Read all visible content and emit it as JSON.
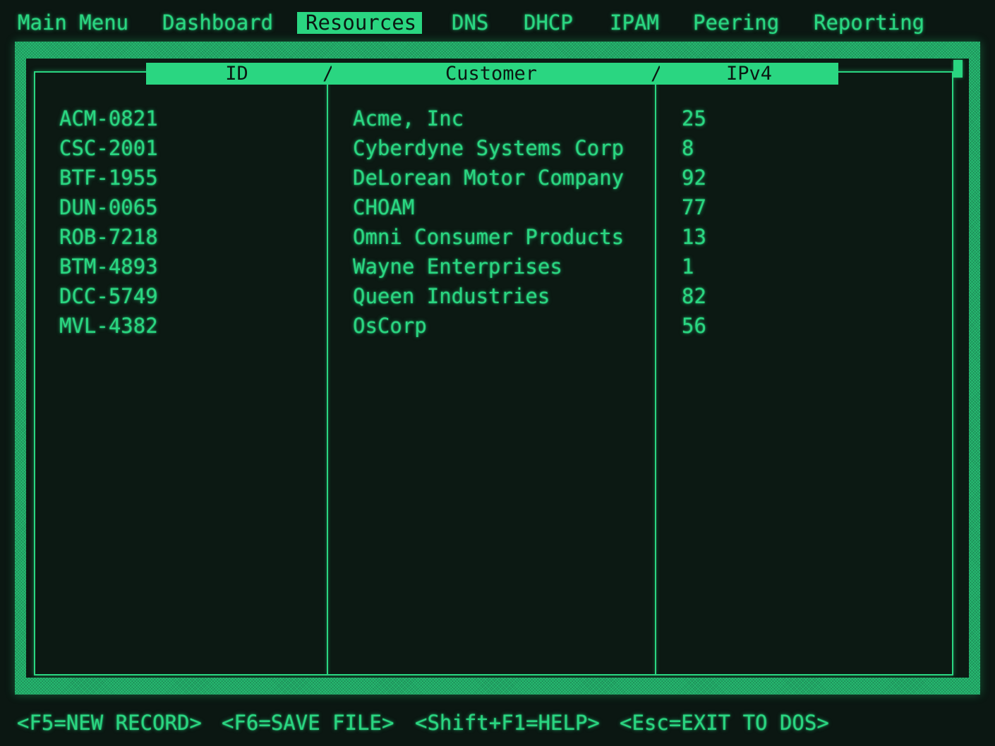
{
  "menu": {
    "items": [
      {
        "label": "Main Menu",
        "active": false
      },
      {
        "label": "Dashboard",
        "active": false
      },
      {
        "label": "Resources",
        "active": true
      },
      {
        "label": "DNS",
        "active": false
      },
      {
        "label": "DHCP",
        "active": false
      },
      {
        "label": "IPAM",
        "active": false
      },
      {
        "label": "Peering",
        "active": false
      },
      {
        "label": "Reporting",
        "active": false
      }
    ]
  },
  "table": {
    "columns": [
      "ID",
      "Customer",
      "IPv4"
    ],
    "separator": "/",
    "rows": [
      {
        "id": "ACM-0821",
        "customer": "Acme, Inc",
        "ipv4": "25"
      },
      {
        "id": "CSC-2001",
        "customer": "Cyberdyne Systems Corp",
        "ipv4": "8"
      },
      {
        "id": "BTF-1955",
        "customer": "DeLorean Motor Company",
        "ipv4": "92"
      },
      {
        "id": "DUN-0065",
        "customer": "CHOAM",
        "ipv4": "77"
      },
      {
        "id": "ROB-7218",
        "customer": "Omni Consumer Products",
        "ipv4": "13"
      },
      {
        "id": "BTM-4893",
        "customer": "Wayne Enterprises",
        "ipv4": "1"
      },
      {
        "id": "DCC-5749",
        "customer": "Queen Industries",
        "ipv4": "82"
      },
      {
        "id": "MVL-4382",
        "customer": "OsCorp",
        "ipv4": "56"
      }
    ]
  },
  "footer": {
    "keys": [
      "<F5=NEW RECORD>",
      "<F6=SAVE FILE>",
      "<Shift+F1=HELP>",
      "<Esc=EXIT TO DOS>"
    ]
  },
  "colors": {
    "phosphor": "#2ad681",
    "background": "#0b1712"
  }
}
